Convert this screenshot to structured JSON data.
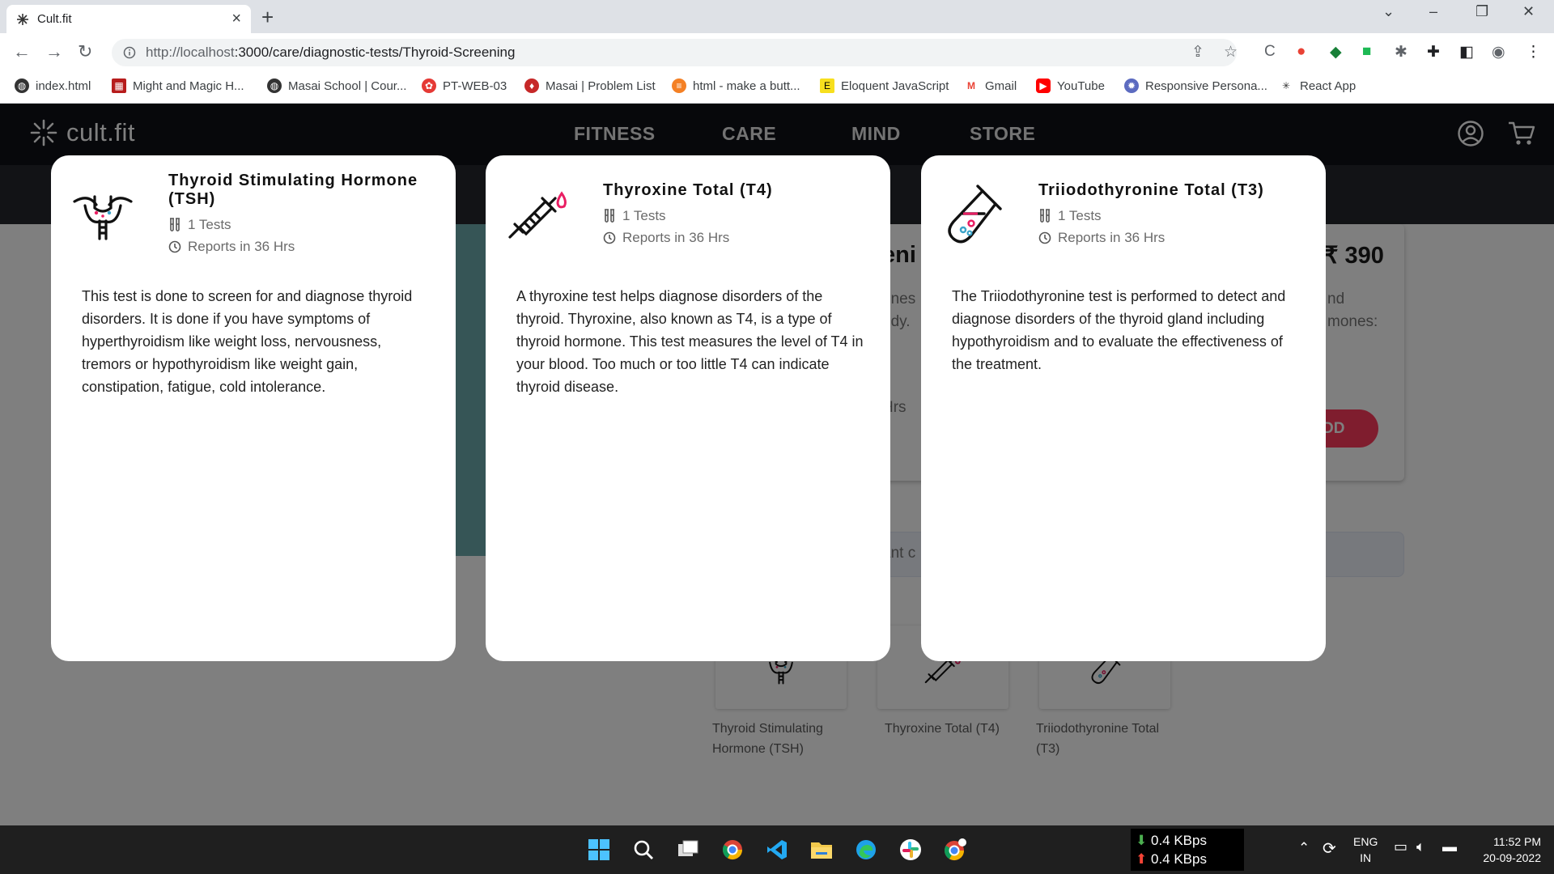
{
  "browser": {
    "tab_title": "Cult.fit",
    "url_host": "http://localhost",
    "url_path": ":3000/care/diagnostic-tests/Thyroid-Screening",
    "bookmarks": [
      "index.html",
      "Might and Magic H...",
      "Masai School | Cour...",
      "PT-WEB-03",
      "Masai | Problem List",
      "html - make a butt...",
      "Eloquent JavaScript",
      "Gmail",
      "YouTube",
      "Responsive Persona...",
      "React App"
    ]
  },
  "site": {
    "logo": "cult.fit",
    "nav": [
      "FITNESS",
      "CARE",
      "MIND",
      "STORE"
    ]
  },
  "background": {
    "price": "₹ 390",
    "fragments": [
      "eni",
      "ones",
      "ody.",
      "nd",
      "mones:",
      "Hrs",
      "ant c"
    ],
    "add_button": "DD"
  },
  "modals": [
    {
      "title": "Thyroid Stimulating Hormone (TSH)",
      "tests": "1 Tests",
      "reports": "Reports in 36 Hrs",
      "description": "This test is done to screen for and diagnose thyroid disorders. It is done if you have symptoms of hyperthyroidism like weight loss, nervousness, tremors or hypothyroidism like weight gain, constipation, fatigue, cold intolerance."
    },
    {
      "title": "Thyroxine Total (T4)",
      "tests": "1 Tests",
      "reports": "Reports in 36 Hrs",
      "description": "A thyroxine test helps diagnose disorders of the thyroid. Thyroxine, also known as T4, is a type of thyroid hormone. This test measures the level of T4 in your blood. Too much or too little T4 can indicate thyroid disease."
    },
    {
      "title": "Triiodothyronine Total (T3)",
      "tests": "1 Tests",
      "reports": "Reports in 36 Hrs",
      "description": "The Triiodothyronine test is performed to detect and diagnose disorders of the thyroid gland including hypothyroidism and to evaluate the effectiveness of the treatment."
    }
  ],
  "tiles": [
    {
      "line1": "Thyroid Stimulating",
      "line2": "Hormone (TSH)"
    },
    {
      "line1": "Thyroxine Total (T4)",
      "line2": ""
    },
    {
      "line1": "Triiodothyronine Total",
      "line2": "(T3)"
    }
  ],
  "taskbar": {
    "net_down": "0.4 KBps",
    "net_up": "0.4 KBps",
    "lang": "ENG",
    "region": "IN",
    "time": "11:52 PM",
    "date": "20-09-2022"
  },
  "colors": {
    "accent_red": "#ff3b5c",
    "header_bg": "#0f1116",
    "teal": "#6cabad"
  }
}
